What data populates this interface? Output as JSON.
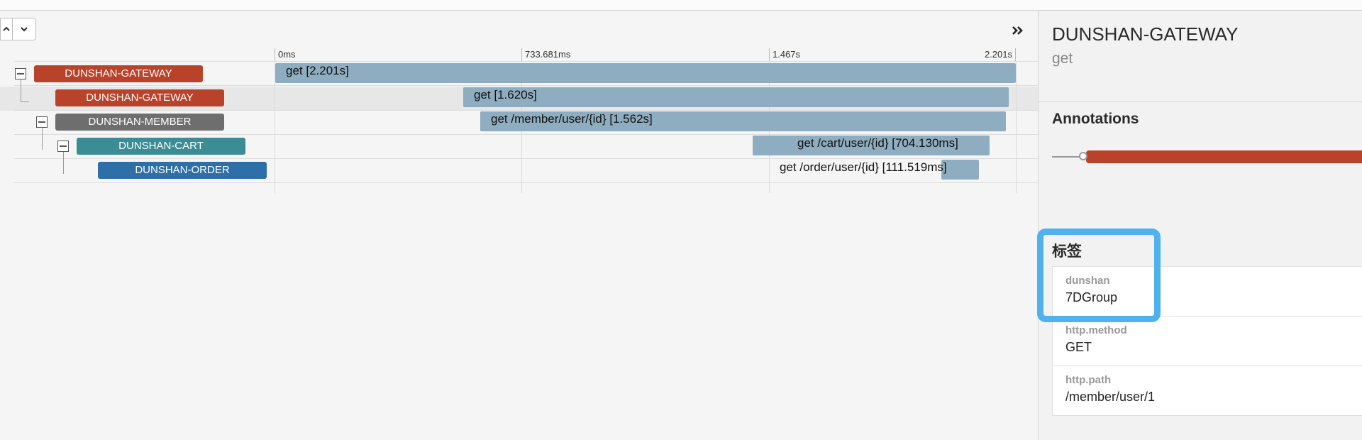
{
  "toolbar": {
    "up_icon": "chevron-up-icon",
    "down_icon": "chevron-down-icon",
    "expand_icon": "double-chevron-right-icon"
  },
  "timeline": {
    "ticks": [
      "0ms",
      "733.681ms",
      "1.467s",
      "2.201s"
    ]
  },
  "spans": [
    {
      "service": "DUNSHAN-GATEWAY",
      "label": "get [2.201s]",
      "color": "#b9432a"
    },
    {
      "service": "DUNSHAN-GATEWAY",
      "label": "get [1.620s]",
      "color": "#b9432a"
    },
    {
      "service": "DUNSHAN-MEMBER",
      "label": "get /member/user/{id} [1.562s]",
      "color": "#6e6e6e"
    },
    {
      "service": "DUNSHAN-CART",
      "label": "get /cart/user/{id} [704.130ms]",
      "color": "#3b8c95"
    },
    {
      "service": "DUNSHAN-ORDER",
      "label": "get /order/user/{id} [111.519ms]",
      "color": "#2f6fa8"
    }
  ],
  "detail": {
    "title": "DUNSHAN-GATEWAY",
    "subtitle": "get",
    "annotations_heading": "Annotations",
    "tags_heading": "标签",
    "tags": [
      {
        "key": "dunshan",
        "value": "7DGroup"
      },
      {
        "key": "http.method",
        "value": "GET"
      },
      {
        "key": "http.path",
        "value": "/member/user/1"
      }
    ]
  }
}
